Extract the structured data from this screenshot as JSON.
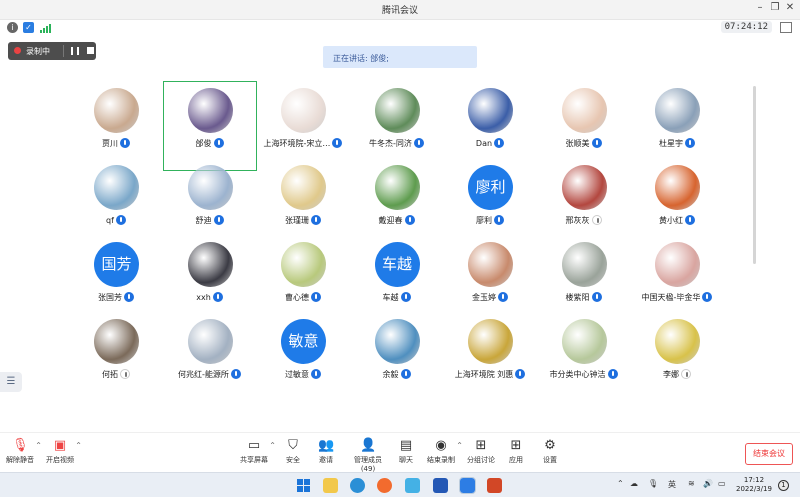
{
  "window": {
    "title": "腾讯会议"
  },
  "status": {
    "clock": "07:24:12"
  },
  "recording": {
    "label": "录制中"
  },
  "speaking": {
    "text": "正在讲话: 邰俊;"
  },
  "participants": [
    {
      "name": "贾川",
      "mic": "on",
      "color": "#c9a98f",
      "avatar_text": ""
    },
    {
      "name": "邰俊",
      "mic": "on",
      "color": "#6a5a8e",
      "avatar_text": "",
      "active": true
    },
    {
      "name": "上海环境院-宋立…",
      "mic": "on",
      "color": "#e9dcd6",
      "avatar_text": ""
    },
    {
      "name": "牛冬杰-同济",
      "mic": "on",
      "color": "#5f8c5a",
      "avatar_text": ""
    },
    {
      "name": "Dan",
      "mic": "on",
      "color": "#3b5ea8",
      "avatar_text": ""
    },
    {
      "name": "张顺美",
      "mic": "on",
      "color": "#e7c6b1",
      "avatar_text": ""
    },
    {
      "name": "杜星宇",
      "mic": "on",
      "color": "#8aa0b8",
      "avatar_text": ""
    },
    {
      "name": "qf",
      "mic": "on",
      "color": "#7aa7c9",
      "avatar_text": ""
    },
    {
      "name": "舒迪",
      "mic": "on",
      "color": "#9cb3cf",
      "avatar_text": ""
    },
    {
      "name": "张瑾珊",
      "mic": "on",
      "color": "#e0c98b",
      "avatar_text": ""
    },
    {
      "name": "戴迎春",
      "mic": "on",
      "color": "#5e9c4e",
      "avatar_text": ""
    },
    {
      "name": "廖利",
      "mic": "on",
      "color": "#1f7be8",
      "avatar_text": "廖利"
    },
    {
      "name": "邢灰灰",
      "mic": "off",
      "color": "#b3473f",
      "avatar_text": ""
    },
    {
      "name": "黄小红",
      "mic": "on",
      "color": "#d7642f",
      "avatar_text": ""
    },
    {
      "name": "张国芳",
      "mic": "on",
      "color": "#1f7be8",
      "avatar_text": "国芳"
    },
    {
      "name": "xxh",
      "mic": "on",
      "color": "#3b3b44",
      "avatar_text": ""
    },
    {
      "name": "曹心德",
      "mic": "on",
      "color": "#b8c97c",
      "avatar_text": ""
    },
    {
      "name": "车越",
      "mic": "on",
      "color": "#1f7be8",
      "avatar_text": "车越"
    },
    {
      "name": "金玉婷",
      "mic": "on",
      "color": "#c88a6c",
      "avatar_text": ""
    },
    {
      "name": "楼紫阳",
      "mic": "on",
      "color": "#9aa39a",
      "avatar_text": ""
    },
    {
      "name": "中国天楹-毕金华",
      "mic": "on",
      "color": "#d9a5a0",
      "avatar_text": ""
    },
    {
      "name": "何拓",
      "mic": "off",
      "color": "#7b6a5a",
      "avatar_text": ""
    },
    {
      "name": "何兆红-能源所",
      "mic": "on",
      "color": "#a3b1c2",
      "avatar_text": ""
    },
    {
      "name": "过敏意",
      "mic": "on",
      "color": "#1f7be8",
      "avatar_text": "敏意"
    },
    {
      "name": "余毅",
      "mic": "on",
      "color": "#4f8fbf",
      "avatar_text": ""
    },
    {
      "name": "上海环境院 刘惠",
      "mic": "on",
      "color": "#c9a63a",
      "avatar_text": ""
    },
    {
      "name": "市分类中心钟洁",
      "mic": "on",
      "color": "#b6c89b",
      "avatar_text": ""
    },
    {
      "name": "李娜",
      "mic": "off",
      "color": "#d8c24a",
      "avatar_text": ""
    }
  ],
  "toolbar": {
    "unmute": "解除静音",
    "video": "开启视频",
    "share": "共享屏幕",
    "security": "安全",
    "invite": "邀请",
    "members": "管理成员(49)",
    "chat": "聊天",
    "record": "结束录制",
    "breakout": "分组讨论",
    "apps": "应用",
    "settings": "设置",
    "end": "结束会议"
  },
  "taskbar": {
    "ime": "英",
    "time": "17:12",
    "date": "2022/3/19",
    "notifications": "1"
  }
}
